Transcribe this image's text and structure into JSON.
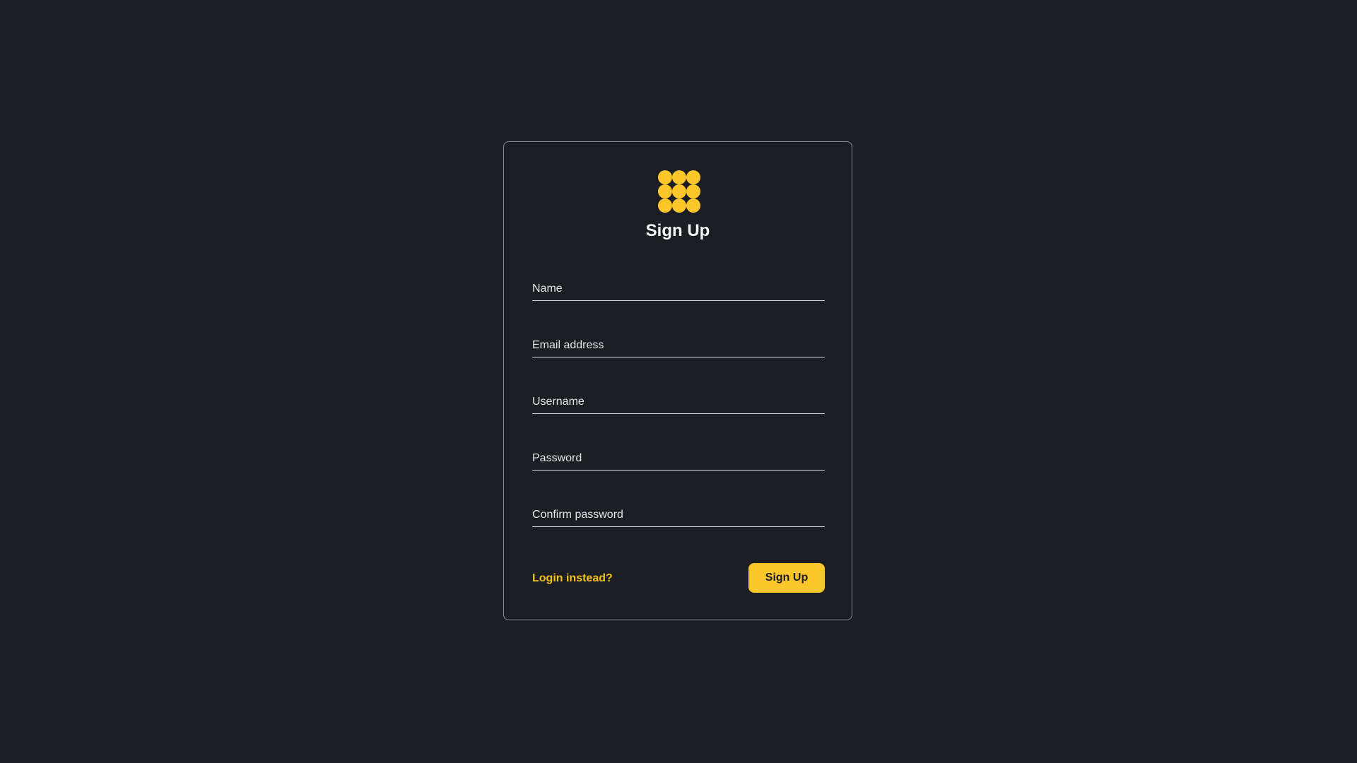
{
  "colors": {
    "background": "#1b1e22",
    "accent": "#fcc72a",
    "border": "#8b8f96",
    "text": "#f3f4f6"
  },
  "logo": {
    "icon": "nine-dot-grid-logo-icon"
  },
  "form": {
    "title": "Sign Up",
    "fields": [
      {
        "placeholder": "Name",
        "value": ""
      },
      {
        "placeholder": "Email address",
        "value": ""
      },
      {
        "placeholder": "Username",
        "value": ""
      },
      {
        "placeholder": "Password",
        "value": ""
      },
      {
        "placeholder": "Confirm password",
        "value": ""
      }
    ],
    "login_link_label": "Login instead?",
    "submit_label": "Sign Up"
  }
}
